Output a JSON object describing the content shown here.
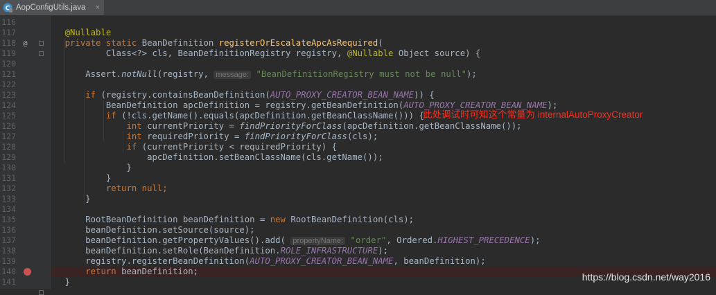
{
  "tab": {
    "filename": "AopConfigUtils.java",
    "close": "×"
  },
  "lines": [
    {
      "num": "116",
      "tokens": []
    },
    {
      "num": "117",
      "tokens": [
        {
          "t": "    "
        },
        {
          "t": "@Nullable",
          "c": "ann"
        }
      ]
    },
    {
      "num": "118",
      "marker": "@",
      "tokens": [
        {
          "t": "    "
        },
        {
          "t": "private static ",
          "c": "kw"
        },
        {
          "t": "BeanDefinition "
        },
        {
          "t": "registerOrEscalateApcAsRequired",
          "c": "fn"
        },
        {
          "t": "("
        }
      ]
    },
    {
      "num": "119",
      "tokens": [
        {
          "t": "            Class<?> cls, BeanDefinitionRegistry registry, "
        },
        {
          "t": "@Nullable ",
          "c": "ann"
        },
        {
          "t": "Object source) {"
        }
      ]
    },
    {
      "num": "120",
      "tokens": []
    },
    {
      "num": "121",
      "tokens": [
        {
          "t": "        Assert."
        },
        {
          "t": "notNull",
          "c": "it"
        },
        {
          "t": "(registry, "
        },
        {
          "t": "message:",
          "c": "hint"
        },
        {
          "t": " "
        },
        {
          "t": "\"BeanDefinitionRegistry must not be null\"",
          "c": "str"
        },
        {
          "t": ");"
        }
      ]
    },
    {
      "num": "122",
      "tokens": []
    },
    {
      "num": "123",
      "tokens": [
        {
          "t": "        "
        },
        {
          "t": "if ",
          "c": "kw"
        },
        {
          "t": "(registry.containsBeanDefinition("
        },
        {
          "t": "AUTO_PROXY_CREATOR_BEAN_NAME",
          "c": "const"
        },
        {
          "t": ")) {"
        }
      ]
    },
    {
      "num": "124",
      "tokens": [
        {
          "t": "            BeanDefinition apcDefinition = registry.getBeanDefinition("
        },
        {
          "t": "AUTO_PROXY_CREATOR_BEAN_NAME",
          "c": "const"
        },
        {
          "t": ");"
        }
      ]
    },
    {
      "num": "125",
      "tokens": [
        {
          "t": "            "
        },
        {
          "t": "if ",
          "c": "kw"
        },
        {
          "t": "(!cls.getName().equals(apcDefinition.getBeanClassName())) {"
        }
      ]
    },
    {
      "num": "126",
      "tokens": [
        {
          "t": "                "
        },
        {
          "t": "int ",
          "c": "kw"
        },
        {
          "t": "currentPriority = "
        },
        {
          "t": "findPriorityForClass",
          "c": "it"
        },
        {
          "t": "(apcDefinition.getBeanClassName());"
        }
      ]
    },
    {
      "num": "127",
      "tokens": [
        {
          "t": "                "
        },
        {
          "t": "int ",
          "c": "kw"
        },
        {
          "t": "requiredPriority = "
        },
        {
          "t": "findPriorityForClass",
          "c": "it"
        },
        {
          "t": "(cls);"
        }
      ]
    },
    {
      "num": "128",
      "tokens": [
        {
          "t": "                "
        },
        {
          "t": "if ",
          "c": "kw"
        },
        {
          "t": "(currentPriority < requiredPriority) {"
        }
      ]
    },
    {
      "num": "129",
      "tokens": [
        {
          "t": "                    apcDefinition.setBeanClassName(cls.getName());"
        }
      ]
    },
    {
      "num": "130",
      "tokens": [
        {
          "t": "                }"
        }
      ]
    },
    {
      "num": "131",
      "tokens": [
        {
          "t": "            }"
        }
      ]
    },
    {
      "num": "132",
      "tokens": [
        {
          "t": "            "
        },
        {
          "t": "return null",
          "c": "kw"
        },
        {
          "t": ";",
          "c": "kw"
        }
      ]
    },
    {
      "num": "133",
      "tokens": [
        {
          "t": "        }"
        }
      ]
    },
    {
      "num": "134",
      "tokens": []
    },
    {
      "num": "135",
      "tokens": [
        {
          "t": "        RootBeanDefinition beanDefinition = "
        },
        {
          "t": "new ",
          "c": "kw"
        },
        {
          "t": "RootBeanDefinition(cls);"
        }
      ]
    },
    {
      "num": "136",
      "tokens": [
        {
          "t": "        beanDefinition.setSource(source);"
        }
      ]
    },
    {
      "num": "137",
      "tokens": [
        {
          "t": "        beanDefinition.getPropertyValues().add( "
        },
        {
          "t": "propertyName:",
          "c": "hint"
        },
        {
          "t": " "
        },
        {
          "t": "\"order\"",
          "c": "str"
        },
        {
          "t": ", Ordered."
        },
        {
          "t": "HIGHEST_PRECEDENCE",
          "c": "const"
        },
        {
          "t": ");"
        }
      ]
    },
    {
      "num": "138",
      "tokens": [
        {
          "t": "        beanDefinition.setRole(BeanDefinition."
        },
        {
          "t": "ROLE_INFRASTRUCTURE",
          "c": "const"
        },
        {
          "t": ");"
        }
      ]
    },
    {
      "num": "139",
      "tokens": [
        {
          "t": "        registry.registerBeanDefinition("
        },
        {
          "t": "AUTO_PROXY_CREATOR_BEAN_NAME",
          "c": "const"
        },
        {
          "t": ", beanDefinition);"
        }
      ]
    },
    {
      "num": "140",
      "breakpoint": true,
      "highlight": true,
      "tokens": [
        {
          "t": "        "
        },
        {
          "t": "return ",
          "c": "kw"
        },
        {
          "t": "beanDefinition;"
        }
      ]
    },
    {
      "num": "141",
      "tokens": [
        {
          "t": "    }"
        }
      ]
    }
  ],
  "annotation": "此处调试时可知这个常量为 internalAutoProxyCreator",
  "watermark": "https://blog.csdn.net/way2016",
  "colors": {
    "keyword": "#cc7832",
    "annotation": "#bbb529",
    "method": "#ffc66d",
    "constant": "#9876aa",
    "string": "#6a8759",
    "breakpoint": "#c75450",
    "note": "#ff2d1c"
  }
}
